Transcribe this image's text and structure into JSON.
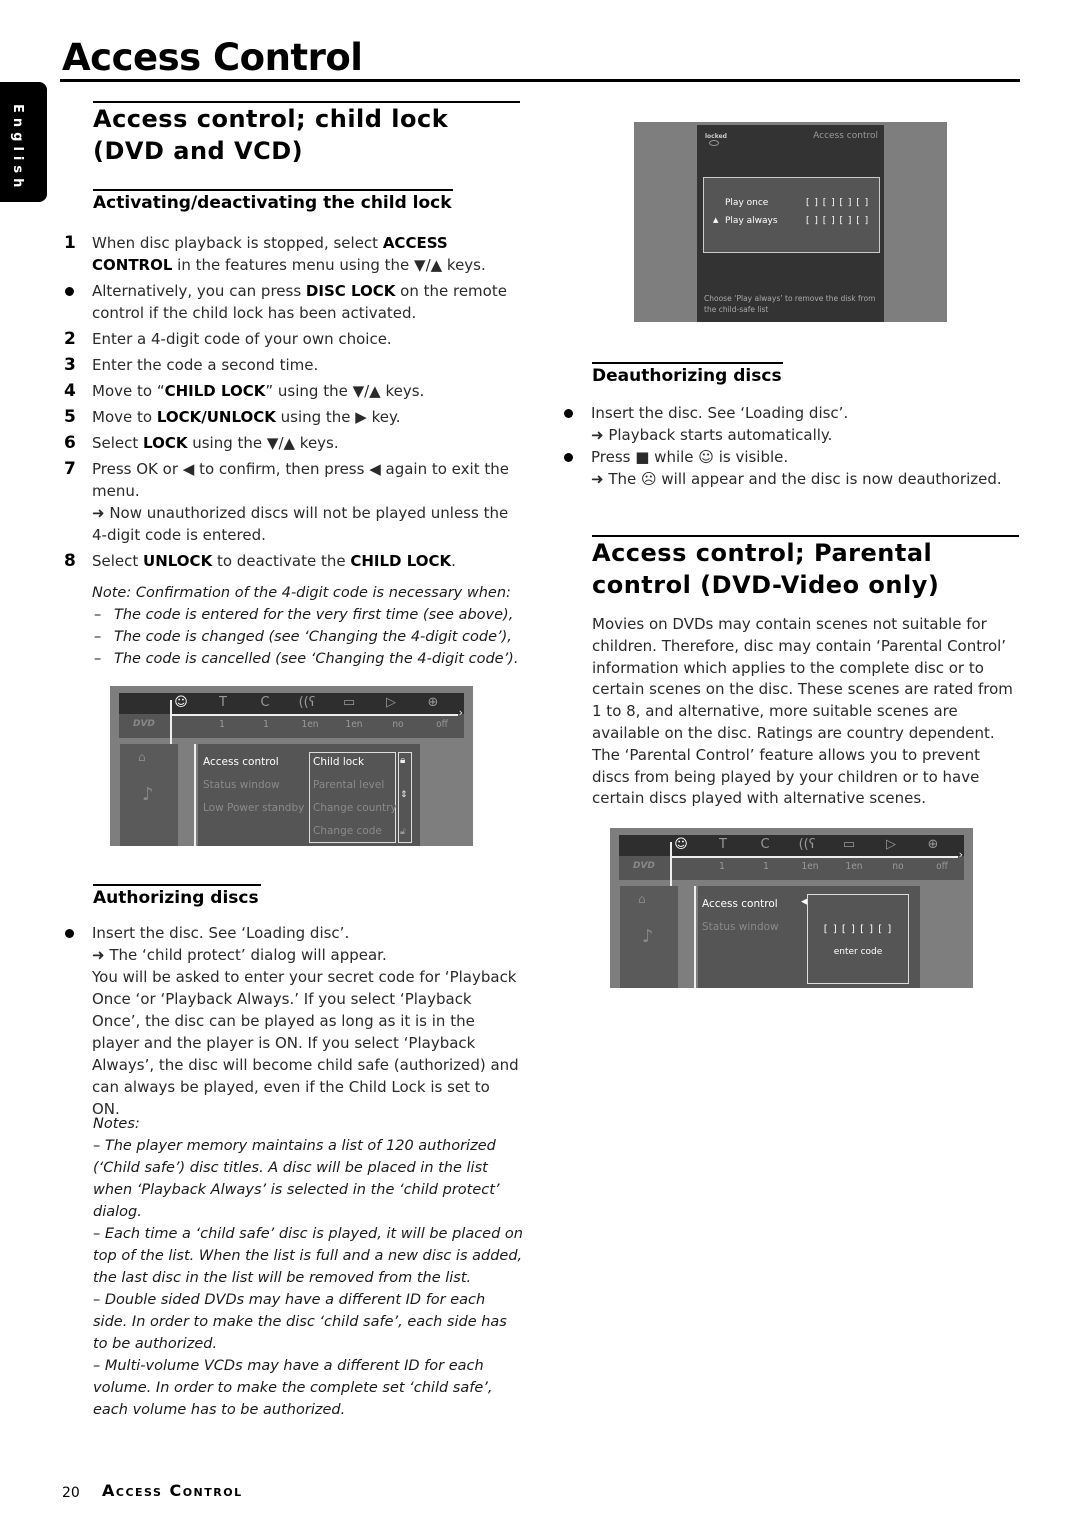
{
  "page": {
    "title": "Access Control",
    "language_tab": "English",
    "footer_page_number": "20",
    "footer_title": "Access Control"
  },
  "left": {
    "section_title_line1": "Access control; child lock",
    "section_title_line2": "(DVD and VCD)",
    "subsection_title": "Activating/deactivating the child lock",
    "steps": [
      {
        "marker": "1",
        "html": "When disc playback is stopped, select <b>ACCESS CONTROL</b> in the features menu using the ▼/▲ keys."
      },
      {
        "marker": "bullet",
        "html": "Alternatively, you can press <b>DISC LOCK</b> on the remote control if the child lock has been activated."
      },
      {
        "marker": "2",
        "html": "Enter a 4-digit code of your own choice."
      },
      {
        "marker": "3",
        "html": "Enter the code a second time."
      },
      {
        "marker": "4",
        "html": "Move to “<b>CHILD LOCK</b>” using the ▼/▲ keys."
      },
      {
        "marker": "5",
        "html": "Move to <b>LOCK/UNLOCK</b> using the ▶ key."
      },
      {
        "marker": "6",
        "html": "Select <b>LOCK</b> using the ▼/▲ keys."
      },
      {
        "marker": "7",
        "html": "Press OK or ◀ to confirm, then press ◀ again to exit the menu.<br>➜ Now unauthorized discs will not be played unless the 4-digit code is entered."
      },
      {
        "marker": "8",
        "html": "Select <b>UNLOCK</b> to deactivate the <b>CHILD LOCK</b>."
      }
    ],
    "note_intro": "Note: Confirmation of the 4-digit code is necessary when:",
    "note_items": [
      "The code is entered for the very first time (see above),",
      "The code is changed (see ‘Changing the 4-digit code’),",
      "The code is cancelled (see ‘Changing the 4-digit code’)."
    ],
    "authorizing_title": "Authorizing discs",
    "authorizing_bullet": "Insert the disc. See ‘Loading disc’.",
    "authorizing_result": "➜ The ‘child protect’ dialog will appear.",
    "authorizing_body": "You will be asked to enter your secret code for ‘Playback Once ‘or ‘Playback Always.’ If you select ‘Playback Once’, the disc can be played as long as it is in the player and the player is ON. If you select ‘Playback Always’, the disc will become child safe (authorized) and can always be played, even if the Child Lock is set to ON.",
    "notes_label": "Notes:",
    "notes": [
      "The player memory maintains a list of 120 authorized (‘Child safe’) disc titles. A disc will be placed in the list when ‘Playback Always’ is selected in the ‘child protect’ dialog.",
      "Each time a ‘child safe’ disc is played, it will be placed on top of the list. When the list is full and a new disc is added, the last disc in the list will be removed from the list.",
      "Double sided DVDs may have a different ID for each side. In order to make the disc ‘child safe’, each side has to be authorized.",
      "Multi-volume VCDs may have a different ID for each volume. In order to make the complete set ‘child safe’, each volume has to be authorized."
    ]
  },
  "screen_menu": {
    "icons": [
      "viewer-icon",
      "title-icon",
      "chapter-icon",
      "audio-icon",
      "subtitle-icon",
      "angle-icon",
      "zoom-icon"
    ],
    "icon_glyphs": [
      "☺",
      "T",
      "C",
      "((ʕ",
      "▭",
      "▷",
      "⊕"
    ],
    "values": [
      "1",
      "1",
      "1en",
      "1en",
      "no",
      "off"
    ],
    "disc_logo": "DVD",
    "menu_items": [
      "Access control",
      "Status window",
      "Low Power standby"
    ],
    "submenu_items": [
      "Child lock",
      "Parental level",
      "Change country",
      "Change code"
    ]
  },
  "screen_dialog": {
    "status": "locked",
    "header": "Access control",
    "options": [
      {
        "label": "Play once",
        "code": "[ ] [ ] [ ] [ ]",
        "selected": false
      },
      {
        "label": "Play always",
        "code": "[ ] [ ] [ ] [ ]",
        "selected": true
      }
    ],
    "hint": "Choose ‘Play always’ to remove the disk from the child-safe list"
  },
  "right": {
    "deauth_title": "Deauthorizing discs",
    "deauth_steps": [
      {
        "text": "Insert the disc. See ‘Loading disc’.",
        "result": "➜ Playback starts automatically."
      },
      {
        "text": "Press ■ while ☺ is visible.",
        "result": "➜ The ☹ will appear and the disc is now deauthorized."
      }
    ],
    "parental_title_line1": "Access control; Parental",
    "parental_title_line2": "control (DVD-Video only)",
    "parental_body": "Movies on DVDs may contain scenes not suitable for children. Therefore, disc may contain ‘Parental Control’ information which applies to the complete disc or to certain scenes on the disc. These scenes are rated from 1 to 8, and alternative, more suitable scenes are available on the disc. Ratings are country dependent. The ‘Parental Control’ feature allows you to prevent discs from being played by your children or to have certain discs played with alternative scenes."
  },
  "screen_code": {
    "menu_items": [
      "Access control",
      "Status window"
    ],
    "code": "[ ] [ ] [ ] [ ]",
    "prompt": "enter code"
  }
}
